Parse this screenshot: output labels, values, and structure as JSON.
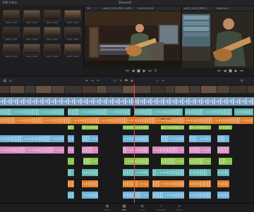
{
  "app": {
    "project_title": "Showreel",
    "top_left_label": "Edit Index"
  },
  "media_pool": {
    "clips": [
      "A001_C001",
      "A001_C002",
      "A001_C003",
      "A001_C004",
      "A002_C001",
      "A002_C002",
      "A002_C003",
      "A002_C004",
      "A003_C001",
      "A003_C002",
      "A003_C003",
      "A003_C004"
    ]
  },
  "source_viewer": {
    "clip_name": "A001_C002_PR5.1.MP4",
    "zoom": "Fit",
    "timecode": "01:01:14:08"
  },
  "timeline_viewer": {
    "clip_name": "A001_C003_PR5.2",
    "timeline_name": "Timeline 1"
  },
  "timeline": {
    "clip_labels": [
      "A001_C001",
      "A001_C002_PR5.1",
      "A001_C003",
      "A002_C004",
      "A001_C003_PR5.2"
    ]
  },
  "page_tabs": [
    "Media",
    "Edit",
    "Color",
    "Fairlight",
    "Deliver"
  ],
  "active_page": "Edit",
  "colors": {
    "video_track": "#7a9ab8",
    "audio_blue": "#6fb3d8",
    "audio_orange": "#e07f2a",
    "audio_green": "#8cc44a",
    "audio_pink": "#d88bbf",
    "audio_teal": "#5fb5b0",
    "playhead": "#e94a4a"
  }
}
